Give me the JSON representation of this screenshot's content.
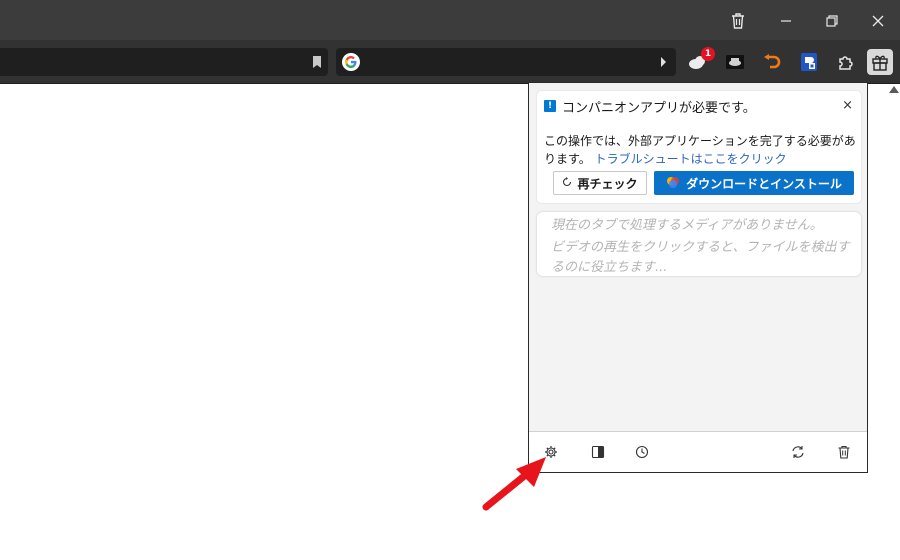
{
  "window_controls": {
    "trash_icon": "trash-icon",
    "minimize_icon": "minimize-icon",
    "restore_icon": "restore-icon",
    "close_icon": "close-icon"
  },
  "toolbar": {
    "bookmark_icon": "bookmark-icon",
    "search_engine_icon": "google-icon",
    "extensions": [
      {
        "name": "cloud-extension-icon",
        "badge": "1"
      },
      {
        "name": "media-extension-icon"
      },
      {
        "name": "undo-extension-icon"
      },
      {
        "name": "shield-extension-icon"
      },
      {
        "name": "puzzle-icon"
      },
      {
        "name": "gift-icon"
      }
    ]
  },
  "popup": {
    "notice": {
      "icon_text": "!",
      "title": "コンパニオンアプリが必要です。",
      "close": "×",
      "body": "この操作では、外部アプリケーションを完了する必要があります。",
      "link": "トラブルシュートはここをクリック",
      "recheck_label": "再チェック",
      "download_label": "ダウンロードとインストール"
    },
    "media": {
      "line1": "現在のタブで処理するメディアがありません。",
      "line2": "ビデオの再生をクリックすると、ファイルを検出するのに役立ちます..."
    },
    "footer": {
      "icons": [
        "settings-icon",
        "sidebar-icon",
        "history-icon",
        "refresh-icon",
        "trash-icon"
      ]
    }
  },
  "colors": {
    "accent": "#0b72c9",
    "link": "#2b66c7",
    "badge": "#e81123",
    "annotation_arrow": "#e8141b"
  }
}
